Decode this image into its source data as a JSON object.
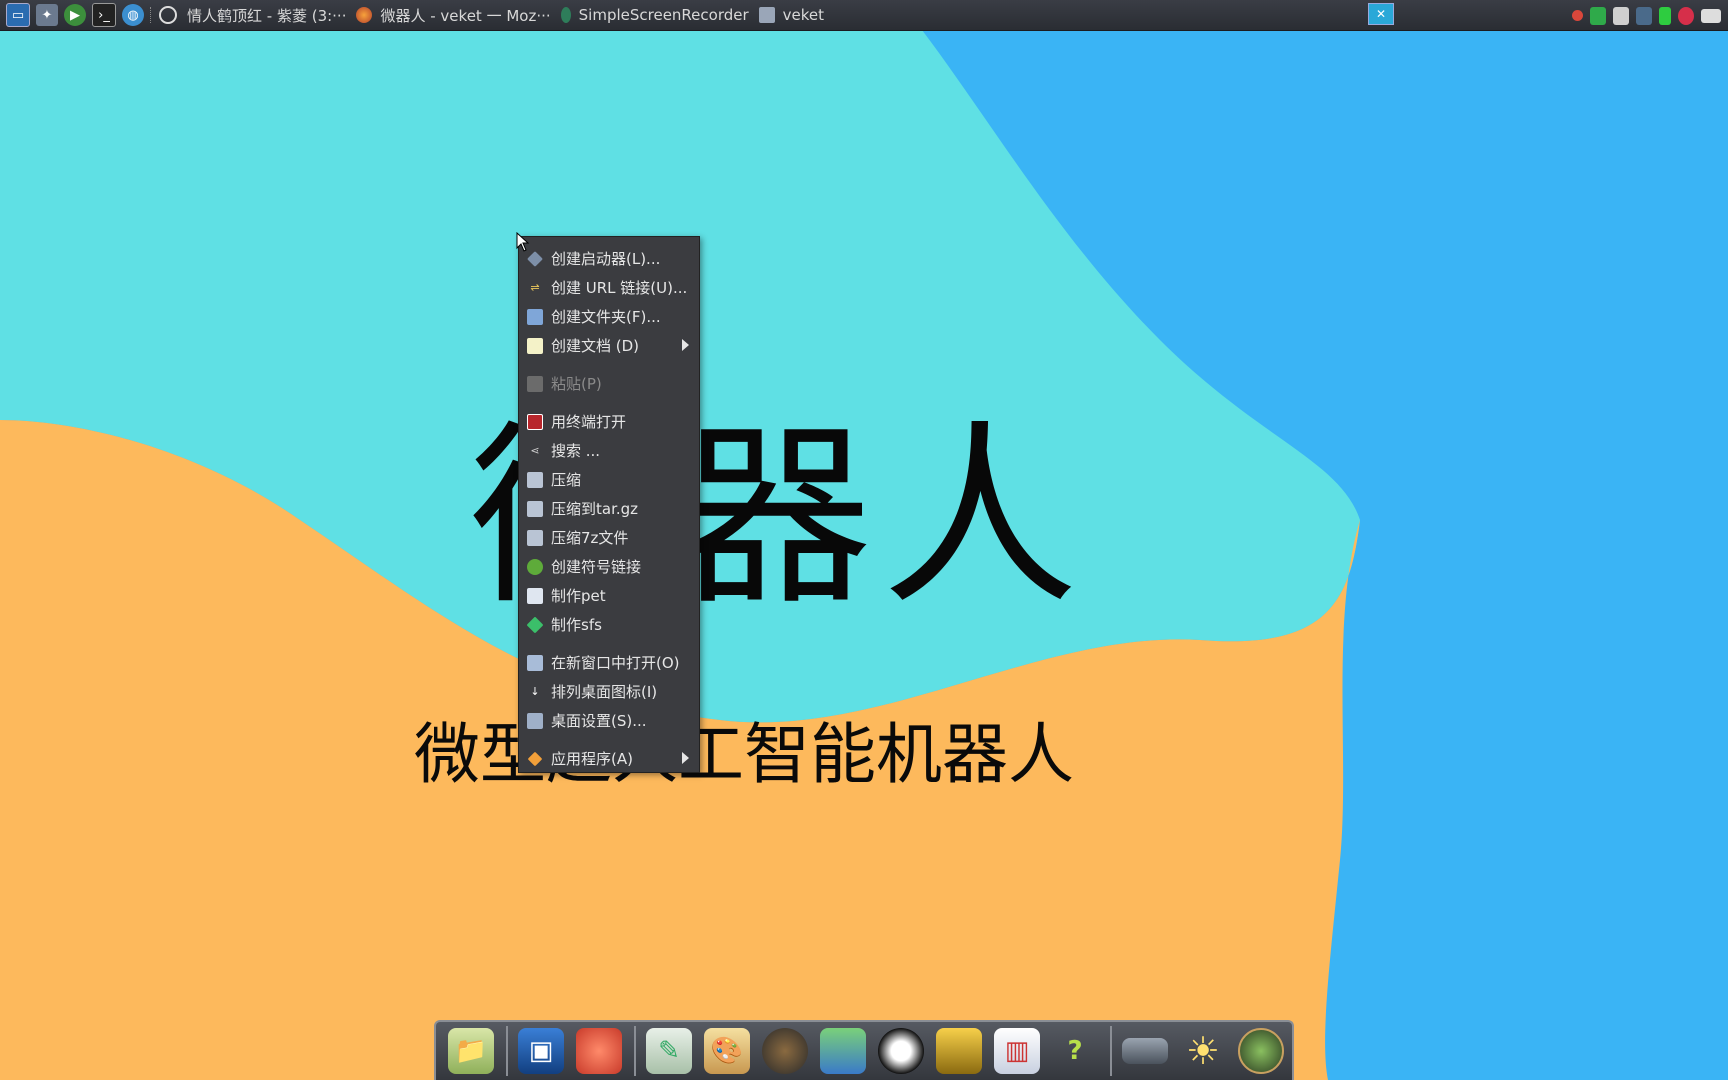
{
  "taskbar": {
    "tasks": [
      {
        "label": "情人鹤顶红 - 紫菱 (3:···"
      },
      {
        "label": "微器人 - veket 一 Moz···"
      },
      {
        "label": "SimpleScreenRecorder"
      },
      {
        "label": "veket"
      }
    ],
    "launchers": [
      "system-monitor-icon",
      "tools-icon",
      "play-icon",
      "terminal-icon",
      "globe-icon"
    ]
  },
  "desktop": {
    "title": "微器人",
    "subtitle": "微型超人工智能机器人"
  },
  "context_menu": {
    "groups": [
      [
        {
          "label": "创建启动器(L)...",
          "icon": "launcher-icon",
          "submenu": false
        },
        {
          "label": "创建 URL 链接(U)...",
          "icon": "link-icon",
          "submenu": false
        },
        {
          "label": "创建文件夹(F)...",
          "icon": "folder-icon",
          "submenu": false
        },
        {
          "label": "创建文档 (D)",
          "icon": "document-icon",
          "submenu": true
        }
      ],
      [
        {
          "label": "粘贴(P)",
          "icon": "paste-icon",
          "submenu": false,
          "disabled": true
        }
      ],
      [
        {
          "label": "用终端打开",
          "icon": "terminal-icon",
          "submenu": false
        },
        {
          "label": "搜索 ...",
          "icon": "search-icon",
          "submenu": false
        },
        {
          "label": "压缩",
          "icon": "archive-icon",
          "submenu": false
        },
        {
          "label": "压缩到tar.gz",
          "icon": "archive-icon",
          "submenu": false
        },
        {
          "label": "压缩7z文件",
          "icon": "archive-icon",
          "submenu": false
        },
        {
          "label": "创建符号链接",
          "icon": "symlink-icon",
          "submenu": false
        },
        {
          "label": "制作pet",
          "icon": "package-icon",
          "submenu": false
        },
        {
          "label": "制作sfs",
          "icon": "sfs-icon",
          "submenu": false
        }
      ],
      [
        {
          "label": "在新窗口中打开(O)",
          "icon": "window-icon",
          "submenu": false
        },
        {
          "label": "排列桌面图标(I)",
          "icon": "sort-icon",
          "submenu": false
        },
        {
          "label": "桌面设置(S)...",
          "icon": "desktop-settings-icon",
          "submenu": false
        }
      ],
      [
        {
          "label": "应用程序(A)",
          "icon": "applications-icon",
          "submenu": true
        }
      ]
    ]
  },
  "dock": {
    "items": [
      "file-manager-icon",
      "monitor-icon",
      "mascot-icon",
      "editor-icon",
      "paint-icon",
      "speaker-icon",
      "network-icon",
      "penguin-icon",
      "book-icon",
      "chart-icon",
      "help-icon",
      "drive-icon",
      "sun-icon",
      "browser-icon"
    ]
  },
  "colors": {
    "wallpaper_blue": "#3ab4f5",
    "wallpaper_cyan": "#5fe0e4",
    "wallpaper_orange": "#fdb95c",
    "menu_bg": "#3b3c40"
  }
}
